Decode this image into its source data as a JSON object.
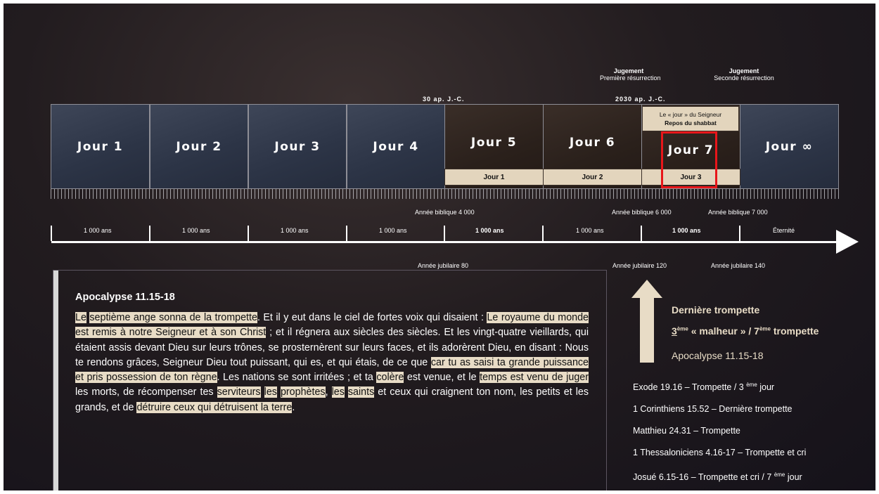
{
  "header": {
    "judgement1_title": "Jugement",
    "judgement1_sub": "Première résurrection",
    "judgement2_title": "Jugement",
    "judgement2_sub": "Seconde résurrection",
    "date1": "30 ap. J.-C.",
    "date2": "2030 ap. J.-C."
  },
  "days": [
    "Jour 1",
    "Jour 2",
    "Jour 3",
    "Jour 4",
    "Jour 5",
    "Jour 6",
    "Jour 7",
    "Jour ∞"
  ],
  "lord_day_box": {
    "line1": "Le « jour » du Seigneur",
    "line2": "Repos du shabbat"
  },
  "sub_days": [
    "Jour 1",
    "Jour 2",
    "Jour 3"
  ],
  "timeline": {
    "biblical_years": [
      "Année biblique 4 000",
      "Année biblique 6 000",
      "Année biblique 7 000"
    ],
    "segments": [
      "1 000 ans",
      "1 000 ans",
      "1 000 ans",
      "1 000 ans",
      "1 000 ans",
      "1 000 ans",
      "1 000 ans"
    ],
    "segment_bold": [
      "1 000 ans",
      "1 000 ans"
    ],
    "eternity": "Éternité",
    "jubilees": [
      "Année jubilaire 80",
      "Année jubilaire 120",
      "Année jubilaire 140"
    ]
  },
  "passage": {
    "title": "Apocalypse 11.15-18",
    "parts": [
      "Le",
      " ",
      "septième ange sonna de la trompette",
      ". Et il y eut dans le ciel de fortes voix qui disaient : ",
      "Le royaume du monde est remis à notre Seigneur et à son Christ",
      " ; et il régnera aux siècles des siècles. Et les vingt-quatre vieillards, qui étaient assis devant Dieu sur leurs trônes, se prosternèrent sur leurs faces, et ils adorèrent Dieu, en disant : Nous te rendons grâces, Seigneur Dieu tout puissant, qui es, et qui étais, de ce que ",
      "car tu as saisi ta grande puissance et pris possession de ton règne",
      ". Les nations se sont irritées ; et ta ",
      "colère",
      " est venue, et le ",
      "temps est venu de juger",
      " les morts, de récompenser tes ",
      "serviteurs",
      " ",
      "les",
      " ",
      "prophètes",
      ", ",
      "les",
      " ",
      "saints",
      " et ceux qui craignent ton nom, les petits et les grands, et de ",
      "détruire ceux qui détruisent la terre",
      "."
    ]
  },
  "right_panel": {
    "heading": "Dernière trompette",
    "malheur_prefix": "3",
    "malheur_sup": "ème",
    "malheur_mid": " « malheur » / 7",
    "malheur_sup2": "ème",
    "malheur_suffix": " trompette",
    "reference": "Apocalypse 11.15-18"
  },
  "references": [
    {
      "text": "Exode 19.16 – Trompette / 3 ",
      "sup": "ème",
      "after": " jour"
    },
    {
      "text": "1 Corinthiens 15.52 – Dernière trompette",
      "sup": "",
      "after": ""
    },
    {
      "text": "Matthieu 24.31 – Trompette",
      "sup": "",
      "after": ""
    },
    {
      "text": "1 Thessaloniciens 4.16-17 – Trompette et cri",
      "sup": "",
      "after": ""
    },
    {
      "text": "Josué 6.15-16 – Trompette et cri / 7 ",
      "sup": "ème",
      "after": " jour"
    }
  ],
  "colors": {
    "highlight": "#e8dcc6",
    "box_border_red": "#e8161a",
    "background": "#1c171b"
  }
}
